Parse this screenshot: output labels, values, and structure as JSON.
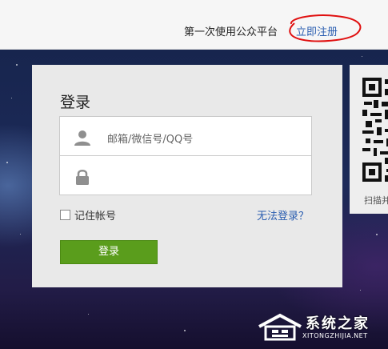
{
  "header": {
    "first_time_text": "第一次使用公众平台",
    "register_link": "立即注册"
  },
  "login": {
    "title": "登录",
    "username_placeholder": "邮箱/微信号/QQ号",
    "password_placeholder": "",
    "remember_label": "记住帐号",
    "cant_login_link": "无法登录？",
    "submit_label": "登录",
    "submit_color": "#5a9d1c"
  },
  "qr": {
    "caption": "扫描并"
  },
  "watermark": {
    "name": "系统之家",
    "url": "XITONGZHIJIA.NET"
  },
  "colors": {
    "link": "#2a5db0",
    "annotation_circle": "#e01010"
  }
}
